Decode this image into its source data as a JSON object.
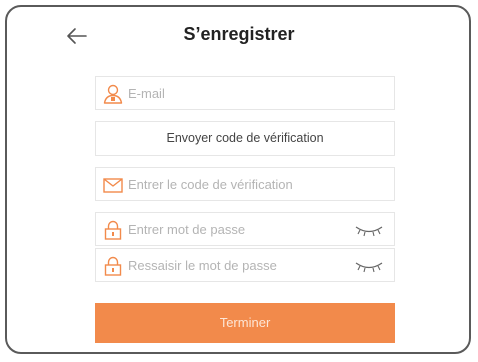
{
  "header": {
    "title": "S’enregistrer",
    "back_icon": "arrow-left-icon"
  },
  "email": {
    "placeholder": "E-mail",
    "value": "",
    "icon": "user-icon"
  },
  "send_code": {
    "label": "Envoyer code de vérification"
  },
  "code": {
    "placeholder": "Entrer le code de vérification",
    "value": "",
    "icon": "envelope-icon"
  },
  "password": {
    "placeholder": "Entrer mot de passe",
    "value": "",
    "icon": "lock-icon",
    "toggle_icon": "eye-closed-icon"
  },
  "confirm_password": {
    "placeholder": "Ressaisir le mot de passe",
    "value": "",
    "icon": "lock-icon",
    "toggle_icon": "eye-closed-icon"
  },
  "submit": {
    "label": "Terminer",
    "color": "#f28a4b"
  }
}
